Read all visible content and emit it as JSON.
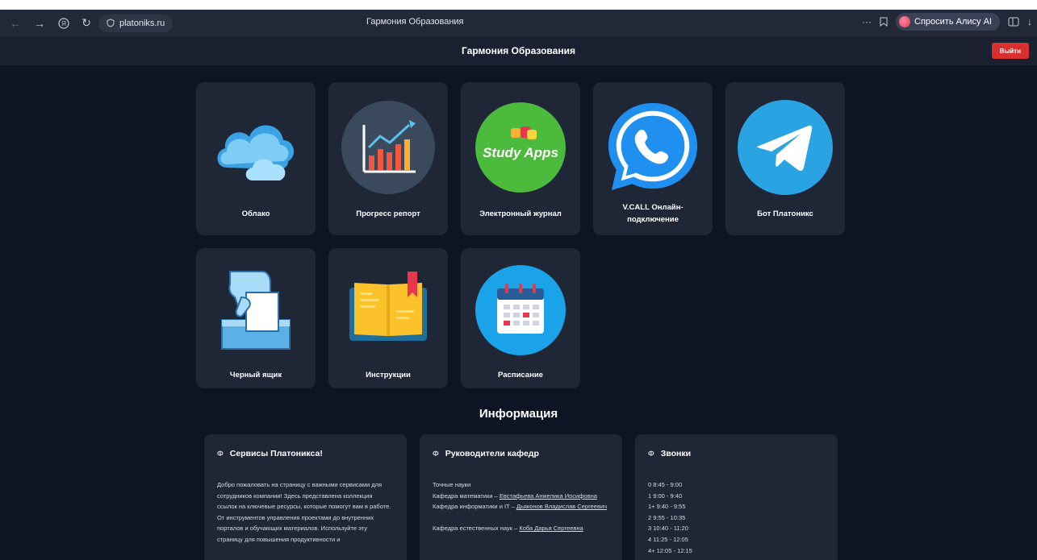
{
  "browser": {
    "url": "platoniks.ru",
    "tab_title": "Гармония Образования",
    "alice_label": "Спросить Алису AI",
    "more": "···"
  },
  "header": {
    "title": "Гармония Образования",
    "logout_label": "Выйти"
  },
  "tiles": [
    {
      "label": "Облако",
      "icon": "cloud-icon"
    },
    {
      "label": "Прогресс репорт",
      "icon": "chart-icon"
    },
    {
      "label": "Электронный журнал",
      "icon": "study-apps-icon",
      "icon_text": "Study Apps"
    },
    {
      "label": "V.CALL Онлайн-подключение",
      "icon": "phone-icon"
    },
    {
      "label": "Бот Платоникс",
      "icon": "telegram-icon"
    },
    {
      "label": "Черный ящик",
      "icon": "ballot-box-icon"
    },
    {
      "label": "Инструкции",
      "icon": "book-icon"
    },
    {
      "label": "Расписание",
      "icon": "calendar-icon"
    }
  ],
  "info": {
    "title": "Информация",
    "cards": [
      {
        "title": "Сервисы Платоникса!",
        "text": "Добро пожаловать на страницу с важными сервисами для сотрудников компании! Здесь представлена коллекция ссылок на ключевые ресурсы, которые помогут вам в работе. От инструментов управления проектами до внутренних порталов и обучающих материалов. Используйте эту страницу для повышения продуктивности и"
      },
      {
        "title": "Руководители кафедр",
        "section1": "Точные науки",
        "line1_prefix": "Кафедра математики – ",
        "line1_link": "Евстафьева Анжелика Иосифовна",
        "line2_prefix": "Кафедра информатики и IT – ",
        "line2_link": "Дьяконов Владислав Сергеевич",
        "line3_prefix": "Кафедра естественных наук – ",
        "line3_link": "Коба Дарья Сергеевна"
      },
      {
        "title": "Звонки",
        "bells": [
          "0 8:45 - 9:00",
          "1 9:00 - 9:40",
          "1+ 9:40 - 9:55",
          "2 9:55 - 10:35",
          "3 10:40 - 11:20",
          "4 11:25 - 12:05",
          "4+ 12:05 - 12:15"
        ]
      }
    ]
  },
  "colors": {
    "background": "#0d1424",
    "tile": "#1f2636",
    "logout": "#d92f2f"
  }
}
